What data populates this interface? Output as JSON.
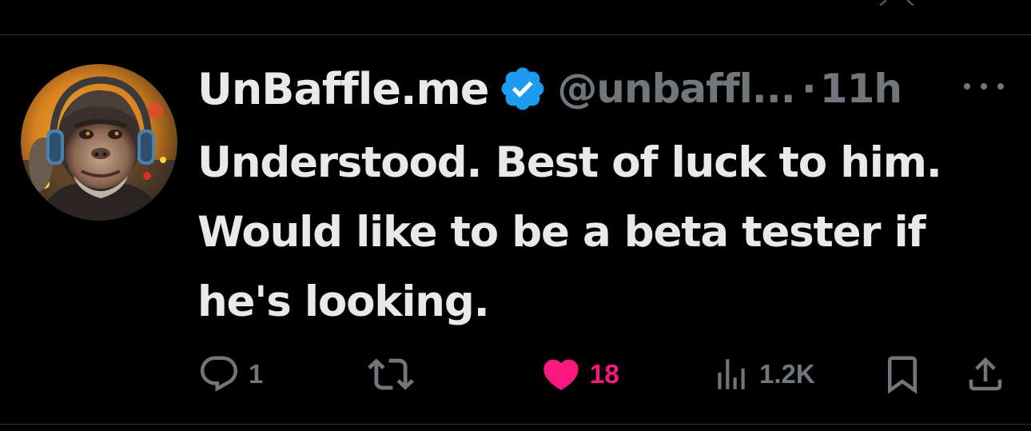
{
  "tweet": {
    "display_name": "UnBaffle.me",
    "handle": "@unbaffl...",
    "separator": "·",
    "time": "11h",
    "verified": true,
    "avatar_icon": "chimpanzee-with-headphones-avatar",
    "text": "Understood. Best of luck to him. Would like to be a beta tester if he's looking."
  },
  "actions": {
    "reply_count": "1",
    "retweet_count": "",
    "like_count": "18",
    "views_count": "1.2K"
  },
  "colors": {
    "background": "#000000",
    "primary_text": "#e7e9ea",
    "secondary_text": "#71767b",
    "verified_blue": "#1d9bf0",
    "like_pink": "#f91880",
    "divider": "#2f3336"
  },
  "icons": {
    "reply": "speech-bubble-icon",
    "retweet": "retweet-icon",
    "like": "heart-icon",
    "views": "bar-chart-icon",
    "bookmark": "bookmark-icon",
    "share": "share-icon",
    "more": "more-dots-icon"
  }
}
